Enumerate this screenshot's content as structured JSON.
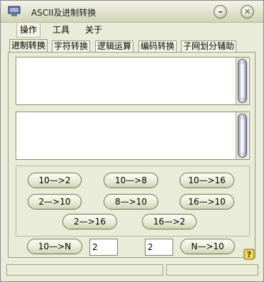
{
  "window": {
    "title": "ASCII及进制转换"
  },
  "menu": [
    "操作",
    "工具",
    "关于"
  ],
  "tabs": [
    "进制转换",
    "字符转换",
    "逻辑运算",
    "编码转换",
    "子网划分辅助"
  ],
  "buttons": {
    "row1": [
      "10—>2",
      "10—>8",
      "10—>16"
    ],
    "row2": [
      "2—>10",
      "8—>10",
      "16—>10"
    ],
    "row3": [
      "2—>16",
      "16—>2"
    ]
  },
  "bottom": {
    "left_button": "10—>N",
    "left_value": "2",
    "right_value": "2",
    "right_button": "N—>10"
  },
  "icons": {
    "app": "monitor-icon",
    "minimize": "minimize-icon",
    "close": "close-icon",
    "help": "help-icon"
  }
}
